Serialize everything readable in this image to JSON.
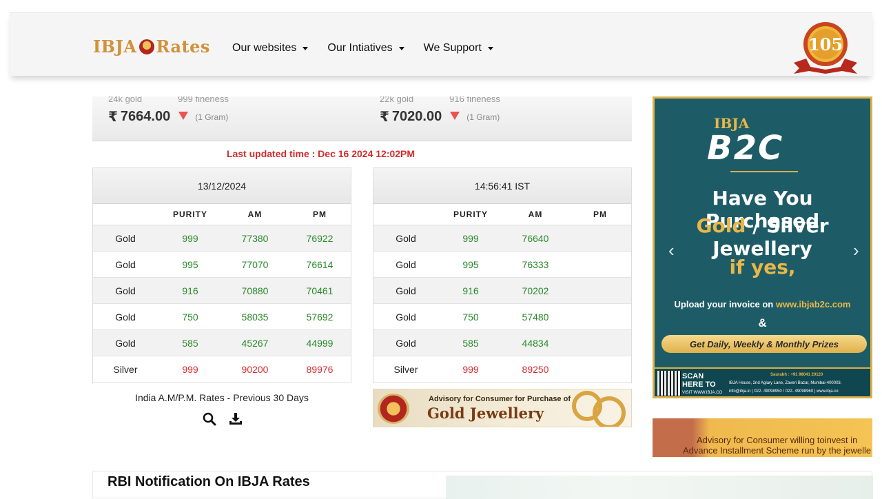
{
  "header": {
    "logo_left": "IBJA",
    "logo_right": "Rates",
    "nav": [
      {
        "label": "Our websites"
      },
      {
        "label": "Our Intiatives"
      },
      {
        "label": "We Support"
      }
    ],
    "badge_number": "105"
  },
  "prices": [
    {
      "type": "24k gold",
      "fineness": "999 fineness",
      "currency": "₹",
      "value": "7664.00",
      "trend": "down",
      "unit": "(1 Gram)"
    },
    {
      "type": "22k gold",
      "fineness": "916 fineness",
      "currency": "₹",
      "value": "7020.00",
      "trend": "down",
      "unit": "(1 Gram)"
    }
  ],
  "last_updated": "Last updated time : Dec 16 2024 12:02PM",
  "columns": {
    "purity": "PURITY",
    "am": "AM",
    "pm": "PM"
  },
  "table_left": {
    "heading": "13/12/2024",
    "rows": [
      {
        "metal": "Gold",
        "purity": "999",
        "am": "77380",
        "pm": "76922"
      },
      {
        "metal": "Gold",
        "purity": "995",
        "am": "77070",
        "pm": "76614"
      },
      {
        "metal": "Gold",
        "purity": "916",
        "am": "70880",
        "pm": "70461"
      },
      {
        "metal": "Gold",
        "purity": "750",
        "am": "58035",
        "pm": "57692"
      },
      {
        "metal": "Gold",
        "purity": "585",
        "am": "45267",
        "pm": "44999"
      },
      {
        "metal": "Silver",
        "purity": "999",
        "am": "90200",
        "pm": "89976"
      }
    ]
  },
  "table_right": {
    "heading": "14:56:41 IST",
    "rows": [
      {
        "metal": "Gold",
        "purity": "999",
        "am": "76640",
        "pm": ""
      },
      {
        "metal": "Gold",
        "purity": "995",
        "am": "76333",
        "pm": ""
      },
      {
        "metal": "Gold",
        "purity": "916",
        "am": "70202",
        "pm": ""
      },
      {
        "metal": "Gold",
        "purity": "750",
        "am": "57480",
        "pm": ""
      },
      {
        "metal": "Gold",
        "purity": "585",
        "am": "44834",
        "pm": ""
      },
      {
        "metal": "Silver",
        "purity": "999",
        "am": "89250",
        "pm": ""
      }
    ]
  },
  "previous_30_days": "India A.M/P.M. Rates - Previous 30 Days",
  "icons": {
    "search": "search-icon",
    "download": "download-icon"
  },
  "advisory_banner": {
    "title": "Advisory for Consumer for Purchase of",
    "subtitle": "Gold Jewellery"
  },
  "right_ad": {
    "logo_top": "IBJA",
    "logo_main": "B2C",
    "line1": "Have You Purchased",
    "line2_gold": "Gold",
    "line2_rest": "/ Silver Jewellery",
    "line3": "if yes,",
    "upload_prefix": "Upload your invoice on",
    "upload_link": "www.ibjab2c.com",
    "amp": "&",
    "prize": "Get Daily, Weekly & Monthly Prizes",
    "scan_1": "SCAN",
    "scan_2": "HERE TO",
    "scan_3": "VISIT WWW.IBJA.CO",
    "contact": "Saurabh : +91 98041 20120",
    "address": "IBJA House, 2nd Agiary Lane, Zaveri Bazar, Mumbai-400003.",
    "emails": "info@ibja.in  |  022- 49098950 / 022- 49098960  |  www.ibja.co"
  },
  "ad2": {
    "line1": "Advisory for Consumer willing toinvest in",
    "line2": "Advance Installment Scheme run by the jewelle"
  },
  "rbi": {
    "title": "RBI Notification On IBJA Rates"
  },
  "colors": {
    "green": "#2b8a2b",
    "red": "#d62b2b",
    "gold": "#d2913a",
    "ad_bg": "#1d5c67"
  }
}
